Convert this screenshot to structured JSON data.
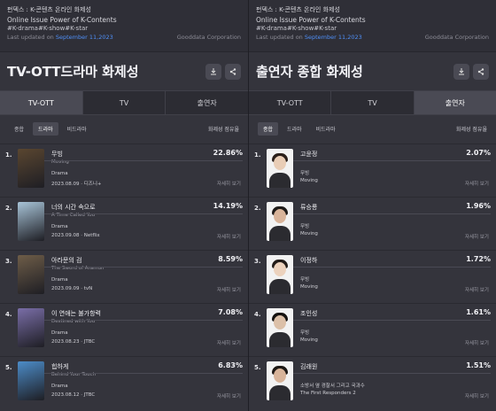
{
  "header": {
    "line1": "펀덱스 : K-콘텐츠 온라인 화제성",
    "line2": "Online Issue Power of K-Contents",
    "updated_prefix": "Last updated on",
    "updated_date": "September 11,2023",
    "company": "Gooddata Corporation",
    "hashtags": "#K-drama#K-show#K-star"
  },
  "left": {
    "title": "TV-OTT드라마 화제성",
    "tabs": [
      "TV-OTT",
      "TV",
      "출연자"
    ],
    "active_tab": 0,
    "pills": [
      "종합",
      "드라마",
      "비드라마"
    ],
    "active_pill": 1,
    "sort_label": "화제성 점유율",
    "detail_label": "자세히 보기",
    "items": [
      {
        "rank": "1.",
        "title": "무빙",
        "en": "Moving",
        "genre": "Drama",
        "meta": "2023.08.09 · 디즈니+",
        "pct": "22.86%",
        "thumb_color": "#5a4630"
      },
      {
        "rank": "2.",
        "title": "너의 시간 속으로",
        "en": "A Time Called You",
        "genre": "Drama",
        "meta": "2023.09.08 · Netflix",
        "pct": "14.19%",
        "thumb_color": "#a8c4d8"
      },
      {
        "rank": "3.",
        "title": "아라문의 검",
        "en": "The Sword of Aramun",
        "genre": "Drama",
        "meta": "2023.09.09 · tvN",
        "pct": "8.59%",
        "thumb_color": "#6e5d48"
      },
      {
        "rank": "4.",
        "title": "이 연애는 불가항력",
        "en": "Destined with You",
        "genre": "Drama",
        "meta": "2023.08.23 · JTBC",
        "pct": "7.08%",
        "thumb_color": "#7a6ea8"
      },
      {
        "rank": "5.",
        "title": "힙하게",
        "en": "Behind Your Touch",
        "genre": "Drama",
        "meta": "2023.08.12 · JTBC",
        "pct": "6.83%",
        "thumb_color": "#4c8cc8"
      }
    ]
  },
  "right": {
    "title": "출연자 종합 화제성",
    "tabs": [
      "TV-OTT",
      "TV",
      "출연자"
    ],
    "active_tab": 2,
    "pills": [
      "종합",
      "드라마",
      "비드라마"
    ],
    "active_pill": 0,
    "sort_label": "화제성 점유율",
    "detail_label": "자세히 보기",
    "items": [
      {
        "rank": "1.",
        "name": "고윤정",
        "sub1": "무빙",
        "sub2": "Moving",
        "pct": "2.07%",
        "skin": "#e9cdb6",
        "hair": "#2a1f1a"
      },
      {
        "rank": "2.",
        "name": "류승룡",
        "sub1": "무빙",
        "sub2": "Moving",
        "pct": "1.96%",
        "skin": "#d9b49a",
        "hair": "#1e1a18"
      },
      {
        "rank": "3.",
        "name": "이정하",
        "sub1": "무빙",
        "sub2": "Moving",
        "pct": "1.72%",
        "skin": "#ecd2bd",
        "hair": "#221c18"
      },
      {
        "rank": "4.",
        "name": "조인성",
        "sub1": "무빙",
        "sub2": "Moving",
        "pct": "1.61%",
        "skin": "#dcc0a8",
        "hair": "#15120f"
      },
      {
        "rank": "5.",
        "name": "김래원",
        "sub1": "소방서 옆 경찰서 그리고 국과수",
        "sub2": "The First Responders 2",
        "pct": "1.51%",
        "skin": "#d8b49a",
        "hair": "#1c1714"
      }
    ]
  }
}
